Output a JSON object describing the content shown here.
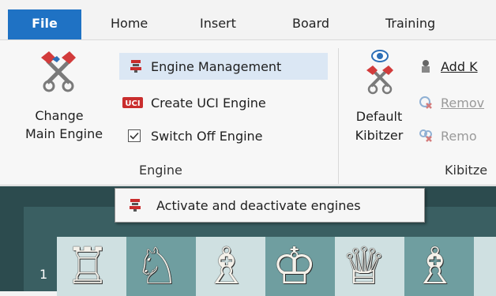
{
  "menu": {
    "file": "File",
    "home": "Home",
    "insert": "Insert",
    "board": "Board",
    "training": "Training"
  },
  "engine_group": {
    "change_main_line1": "Change",
    "change_main_line2": "Main Engine",
    "engine_management": "Engine Management",
    "create_uci": "Create UCI Engine",
    "switch_off": "Switch Off Engine",
    "label": "Engine"
  },
  "kibitzer_group": {
    "default_line1": "Default",
    "default_line2": "Kibitzer",
    "add_k": "Add K",
    "remove1": "Remov",
    "remove2": "Remo",
    "label": "Kibitze"
  },
  "tooltip": {
    "text": "Activate and deactivate engines"
  },
  "board": {
    "rank_label": "1",
    "pieces": [
      "♖",
      "♘",
      "♗",
      "♔",
      "♕",
      "♗"
    ]
  },
  "colors": {
    "accent": "#1f72c4",
    "highlight": "#dbe7f4",
    "board_light": "#cfe0e1",
    "board_dark": "#6f9ea0"
  }
}
